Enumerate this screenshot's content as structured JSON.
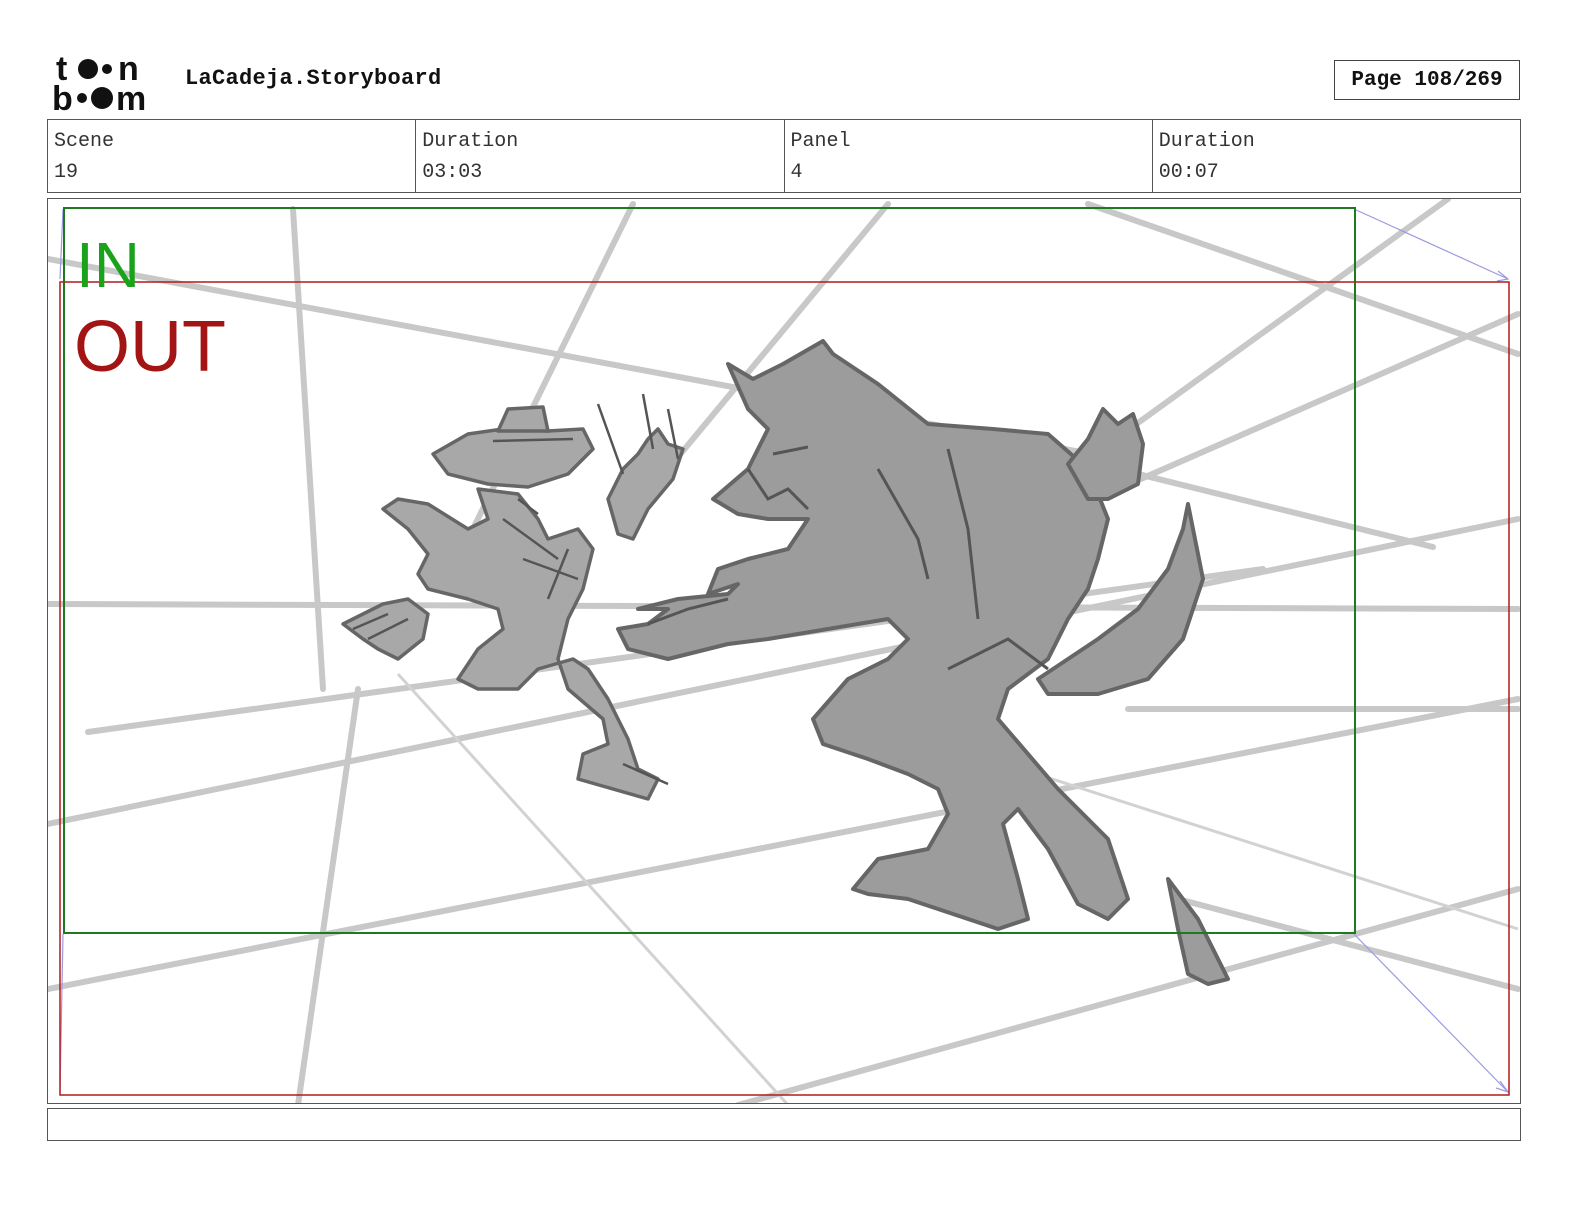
{
  "header": {
    "logo_alt": "toon boom",
    "title": "LaCadeja.Storyboard",
    "page_label": "Page 108/269"
  },
  "info": {
    "scene_label": "Scene",
    "scene_value": "19",
    "duration_label": "Duration",
    "duration_value": "03:03",
    "panel_label": "Panel",
    "panel_value": "4",
    "panel_duration_label": "Duration",
    "panel_duration_value": "00:07"
  },
  "panel": {
    "in_label": "IN",
    "out_label": "OUT",
    "colors": {
      "in": "#1aa31a",
      "out": "#a31414",
      "in_frame": "#1e7a1e",
      "out_frame": "#b01c1c",
      "sketch_fill": "#9c9c9c",
      "sketch_line": "#666666",
      "perspective": "#c8c8c8",
      "camera_path": "#9a9ae0"
    }
  },
  "caption": ""
}
